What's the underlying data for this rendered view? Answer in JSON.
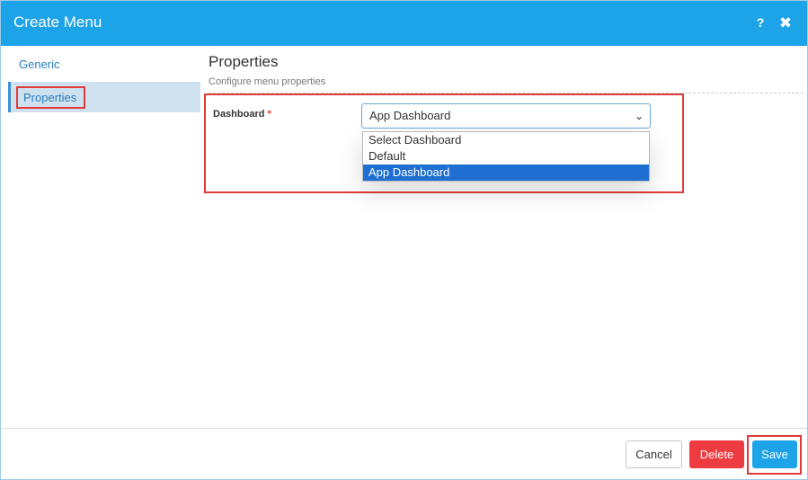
{
  "dialog": {
    "title": "Create Menu",
    "help_icon": "help-icon",
    "help_glyph": "?",
    "close_icon": "close-icon",
    "close_glyph": "✖"
  },
  "sidebar": {
    "items": [
      {
        "label": "Generic",
        "active": false
      },
      {
        "label": "Properties",
        "active": true
      }
    ]
  },
  "section": {
    "title": "Properties",
    "subtitle": "Configure menu properties"
  },
  "form": {
    "dashboard": {
      "label": "Dashboard",
      "required_mark": "*",
      "selected": "App Dashboard",
      "chevron_icon": "chevron-down-icon",
      "chevron_glyph": "⌄",
      "options": [
        "Select Dashboard",
        "Default",
        "App Dashboard"
      ],
      "highlighted_option": "App Dashboard"
    }
  },
  "footer": {
    "cancel_label": "Cancel",
    "delete_label": "Delete",
    "save_label": "Save"
  },
  "colors": {
    "header": "#1ca3e8",
    "highlight_outline": "#e03a3a",
    "delete": "#ee3b40",
    "selected_option": "#1f6fd2"
  }
}
